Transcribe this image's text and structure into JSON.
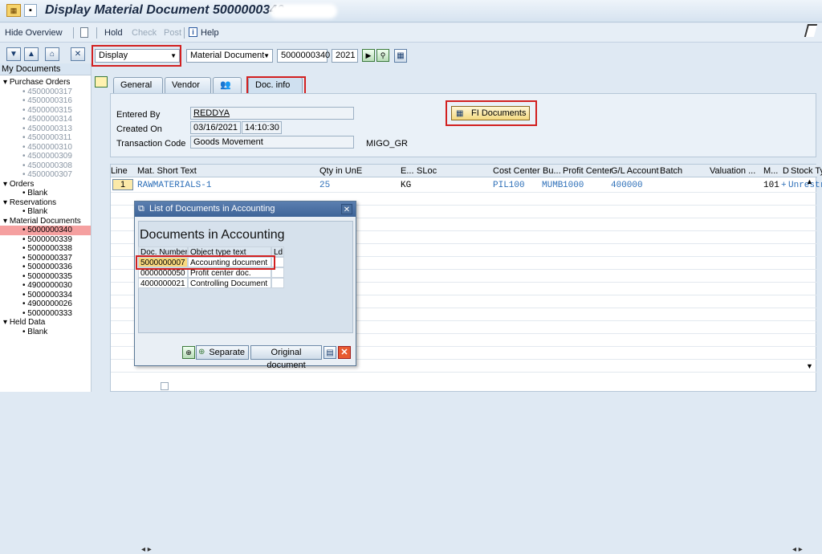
{
  "window": {
    "title": "Display Material Document 5000000340 -"
  },
  "toolbar": {
    "hide_overview": "Hide Overview",
    "hold": "Hold",
    "check": "Check",
    "post": "Post",
    "help": "Help"
  },
  "selector": {
    "action": "Display",
    "object": "Material Document",
    "doc_number": "5000000340",
    "year": "2021"
  },
  "tree": {
    "header": "My Documents",
    "purchase_orders_label": "Purchase Orders",
    "purchase_orders": [
      "4500000317",
      "4500000316",
      "4500000315",
      "4500000314",
      "4500000313",
      "4500000311",
      "4500000310",
      "4500000309",
      "4500000308",
      "4500000307"
    ],
    "orders_label": "Orders",
    "orders": [
      "Blank"
    ],
    "reservations_label": "Reservations",
    "reservations": [
      "Blank"
    ],
    "material_documents_label": "Material Documents",
    "material_documents": [
      "5000000340",
      "5000000339",
      "5000000338",
      "5000000337",
      "5000000336",
      "5000000335",
      "4900000030",
      "5000000334",
      "4900000026",
      "5000000333"
    ],
    "held_data_label": "Held Data",
    "held_data": [
      "Blank"
    ]
  },
  "tabs": [
    "General",
    "Vendor",
    "",
    "Doc. info"
  ],
  "docinfo": {
    "entered_by_label": "Entered By",
    "entered_by": "REDDYA",
    "created_on_label": "Created On",
    "created_on_date": "03/16/2021",
    "created_on_time": "14:10:30",
    "transaction_code_label": "Transaction Code",
    "transaction_code": "Goods Movement",
    "transaction_code_id": "MIGO_GR",
    "fi_documents": "FI Documents"
  },
  "grid": {
    "headers": [
      "Line",
      "Mat. Short Text",
      "Qty in UnE",
      "E...",
      "SLoc",
      "Cost Center",
      "Bu...",
      "Profit Center",
      "G/L Account",
      "Batch",
      "Valuation ...",
      "M...",
      "D",
      "Stock Ty"
    ],
    "row": {
      "line": "1",
      "mat_short_text": "RAWMATERIALS-1",
      "qty": "25",
      "unit": "KG",
      "cost_center": "PIL100",
      "bu": "MUMB",
      "profit_center": "1000",
      "gl_account": "400000",
      "m": "101",
      "d": "+",
      "stock_type": "Unrestr"
    }
  },
  "dialog": {
    "title": "List of Documents in Accounting",
    "heading": "Documents in Accounting",
    "columns": [
      "Doc. Number",
      "Object type text",
      "Ld"
    ],
    "rows": [
      {
        "doc": "5000000007",
        "text": "Accounting document"
      },
      {
        "doc": "0000000050",
        "text": "Profit center doc."
      },
      {
        "doc": "4000000021",
        "text": "Controlling Document"
      }
    ],
    "separate": "Separate",
    "original_document": "Original document"
  }
}
